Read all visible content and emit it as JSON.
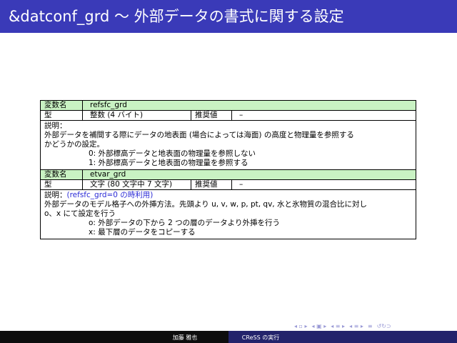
{
  "title": "&datconf_grd 〜 外部データの書式に関する設定",
  "rows": {
    "var1": {
      "name_label": "変数名",
      "name": "refsfc_grd",
      "type_label": "型",
      "type": "整数 (4 バイト)",
      "rec_label": "推奨値",
      "rec": "–",
      "desc_label": "説明：",
      "desc_lines": [
        "外部データを補間する際にデータの地表面 (場合によっては海面) の高度と物理量を参照する",
        "かどうかの設定。"
      ],
      "options": [
        "0:  外部標高データと地表面の物理量を参照しない",
        "1:  外部標高データと地表面の物理量を参照する"
      ]
    },
    "var2": {
      "name_label": "変数名",
      "name": "etvar_grd",
      "type_label": "型",
      "type": "文字 (80 文字中 7 文字)",
      "rec_label": "推奨値",
      "rec": "–",
      "desc_label": "説明：",
      "desc_note": "(refsfc_grd=0 の時利用)",
      "desc_lines": [
        "外部データのモデル格子への外挿方法。先頭より u, v, w, p, pt, qv, 水と氷物質の混合比に対し",
        "o、x にて設定を行う"
      ],
      "options": [
        "o:  外部データの下から 2 つの層のデータより外挿を行う",
        "x:  最下層のデータをコピーする"
      ]
    }
  },
  "footer": {
    "author": "加藤 雅也",
    "talk": "CReSS の実行"
  },
  "nav": {
    "symbols": [
      "◂ ▫ ▸",
      "◂ ▣ ▸",
      "◂ ≡ ▸",
      "◂ ≡ ▸",
      "≡",
      "↺↻⊃"
    ]
  },
  "colors": {
    "title_bar": "#3a3ab8",
    "header_row": "#c9f2c3",
    "note_text": "#2b2bd6",
    "footer_left": "#0d0d0d",
    "footer_right": "#23236b"
  }
}
